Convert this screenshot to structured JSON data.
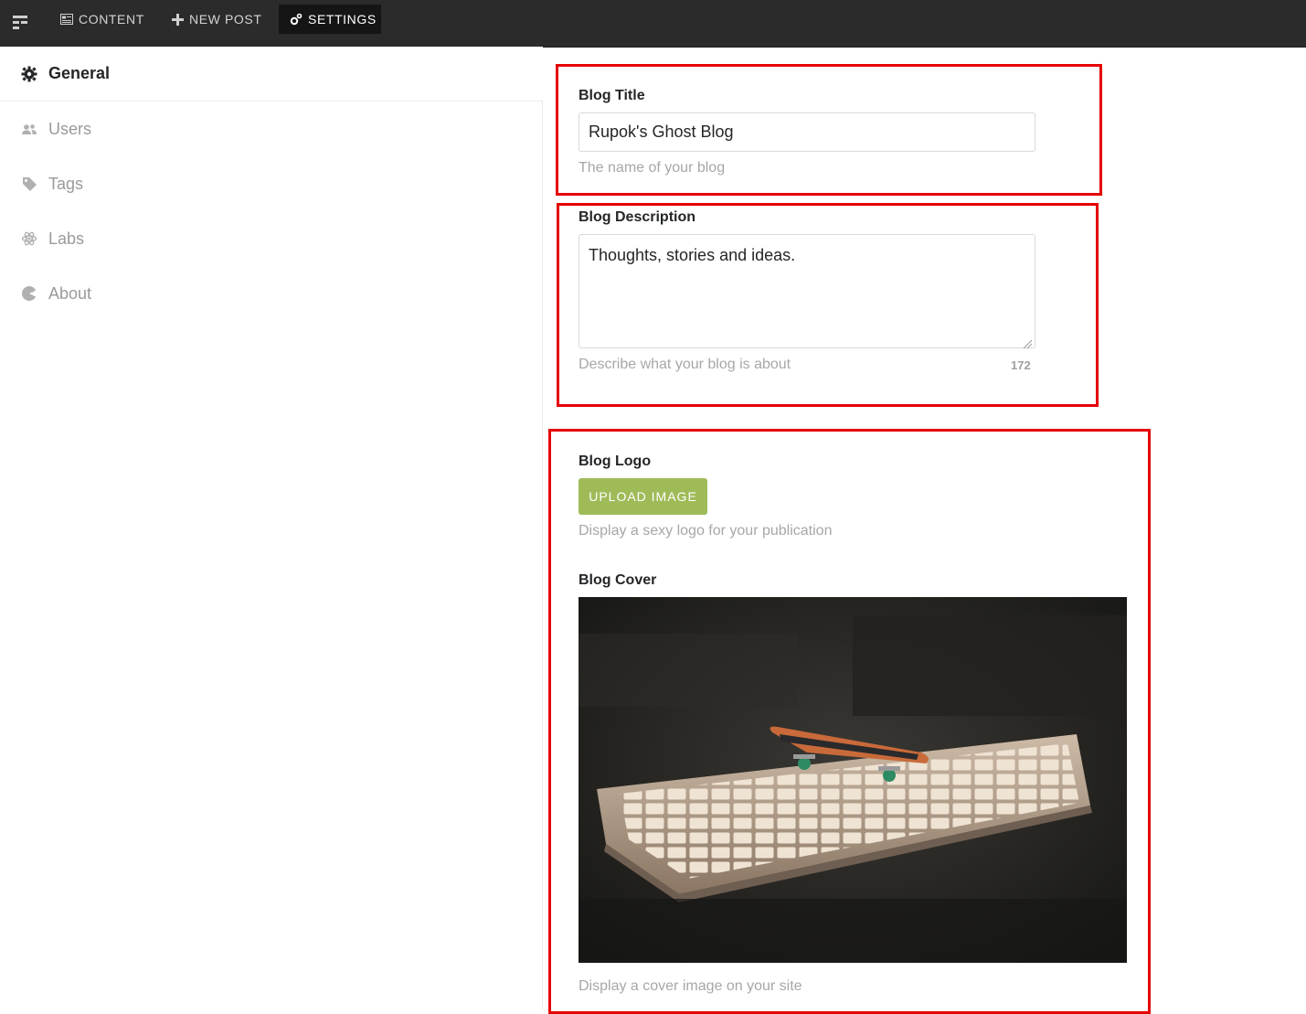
{
  "topbar": {
    "menu_icon": "menu-icon",
    "nav": [
      {
        "label": "CONTENT",
        "icon": "content-icon"
      },
      {
        "label": "NEW POST",
        "icon": "plus-icon"
      },
      {
        "label": "SETTINGS",
        "icon": "gear-icon",
        "active": true
      }
    ]
  },
  "sidebar": {
    "items": [
      {
        "label": "General",
        "icon": "gear-icon",
        "active": true
      },
      {
        "label": "Users",
        "icon": "users-icon"
      },
      {
        "label": "Tags",
        "icon": "tag-icon"
      },
      {
        "label": "Labs",
        "icon": "atom-icon"
      },
      {
        "label": "About",
        "icon": "about-icon"
      }
    ]
  },
  "form": {
    "title": {
      "label": "Blog Title",
      "value": "Rupok's Ghost Blog",
      "hint": "The name of your blog"
    },
    "description": {
      "label": "Blog Description",
      "value": "Thoughts, stories and ideas.",
      "hint": "Describe what your blog is about",
      "counter": "172"
    },
    "logo": {
      "label": "Blog Logo",
      "button": "UPLOAD IMAGE",
      "hint": "Display a sexy logo for your publication"
    },
    "cover": {
      "label": "Blog Cover",
      "hint": "Display a cover image on your site"
    }
  },
  "colors": {
    "highlight": "#e50000",
    "topbar": "#2b2b2b",
    "upload_button": "#9fbb58"
  }
}
